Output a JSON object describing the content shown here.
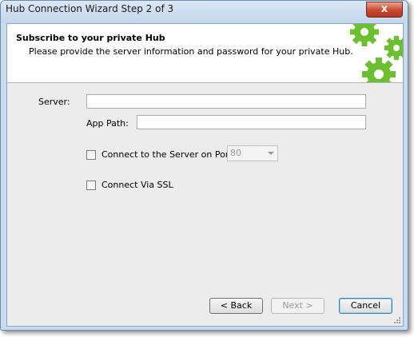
{
  "window": {
    "title": "Hub Connection Wizard Step 2 of 3",
    "close_glyph": "x"
  },
  "header": {
    "title": "Subscribe to your private Hub",
    "subtitle": "Please provide the server information and password for your private Hub."
  },
  "form": {
    "server_label": "Server:",
    "server_value": "",
    "app_path_label": "App Path:",
    "app_path_value": "",
    "port_checkbox_label": "Connect to the Server on Port:",
    "port_checked": false,
    "port_value": "80",
    "ssl_checkbox_label": "Connect Via SSL",
    "ssl_checked": false
  },
  "buttons": {
    "back": "< Back",
    "next": "Next >",
    "cancel": "Cancel"
  },
  "colors": {
    "gear_green": "#6cbf2f",
    "gear_dark": "#4e9a1c"
  }
}
